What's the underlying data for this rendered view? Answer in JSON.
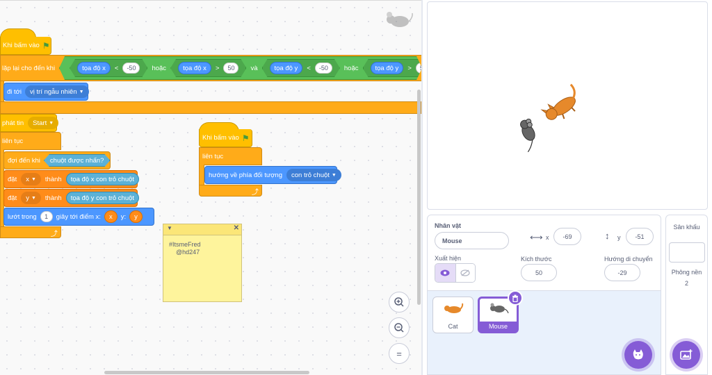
{
  "scripts": {
    "hat1_label": "Khi bấm vào",
    "repeat_until_label": "lặp lại cho đến khi",
    "cond_x_label": "tọa độ x",
    "cond_y_label": "tọa độ y",
    "lt": "<",
    "gt": ">",
    "v_neg50": "-50",
    "v_50": "50",
    "or_label": "hoặc",
    "and_label": "và",
    "goto_label": "đi tới",
    "goto_target": "vị trí ngẫu nhiên",
    "broadcast_label": "phát tin",
    "broadcast_msg": "Start",
    "forever_label": "liên tục",
    "wait_until_label": "đợi đến khi",
    "mouse_down_label": "chuột được nhấn?",
    "set_label": "đặt",
    "var_x": "x",
    "var_y": "y",
    "to_label": "thành",
    "mouse_x_label": "tọa độ x con trỏ chuột",
    "mouse_y_label": "tọa độ y con trỏ chuột",
    "glide_label": "lướt trong",
    "glide_secs": "1",
    "glide_mid": "giây tới điểm x:",
    "glide_y_label": "y:",
    "hat2_label": "Khi bấm vào",
    "forever2_label": "liên tục",
    "point_label": "hướng về phía đối tượng",
    "point_target": "con trỏ chuột"
  },
  "note": {
    "text": "#ItsmeFred\n    @hd247"
  },
  "zoom": {
    "in": "+",
    "out": "−",
    "reset": "="
  },
  "sprite_info": {
    "sprite_label": "Nhân vật",
    "sprite_name": "Mouse",
    "x_label": "x",
    "x_value": "-69",
    "y_label": "y",
    "y_value": "-51",
    "show_label": "Xuất hiện",
    "size_label": "Kích thước",
    "size_value": "50",
    "direction_label": "Hướng di chuyển",
    "direction_value": "-29"
  },
  "sprites": [
    {
      "name": "Cat",
      "selected": false
    },
    {
      "name": "Mouse",
      "selected": true
    }
  ],
  "stage_panel": {
    "title": "Sân khấu",
    "backdrops_label": "Phông nền",
    "backdrops_count": "2"
  },
  "colors": {
    "events": "#ffbf00",
    "control": "#ffab19",
    "motion": "#4c97ff",
    "sensing": "#5cb1d6",
    "operators": "#59c059",
    "variables": "#ff8c1a",
    "accent": "#855cd6"
  }
}
